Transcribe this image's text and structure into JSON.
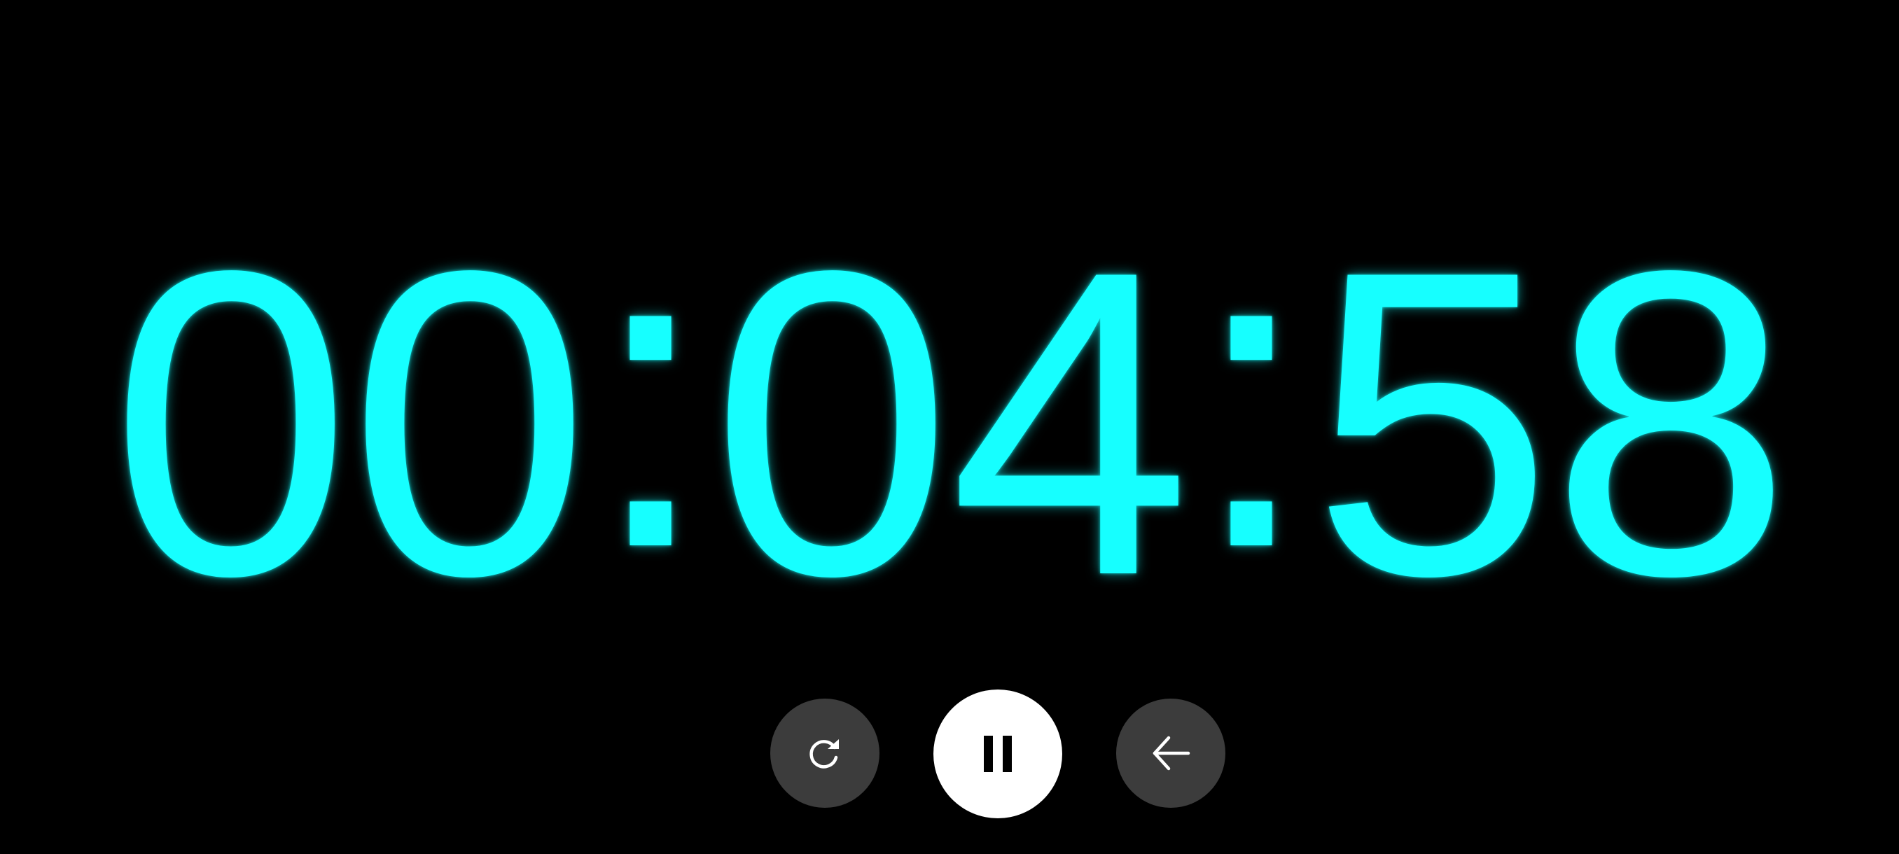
{
  "timer": {
    "hours": "00",
    "minutes": "04",
    "seconds": "58",
    "separator": ":"
  },
  "controls": {
    "restart_icon": "restart-icon",
    "pause_icon": "pause-icon",
    "back_icon": "back-arrow-icon"
  },
  "colors": {
    "digits": "#16ffff",
    "background": "#000000",
    "secondary_button": "#3c3c3c",
    "primary_button": "#ffffff"
  }
}
